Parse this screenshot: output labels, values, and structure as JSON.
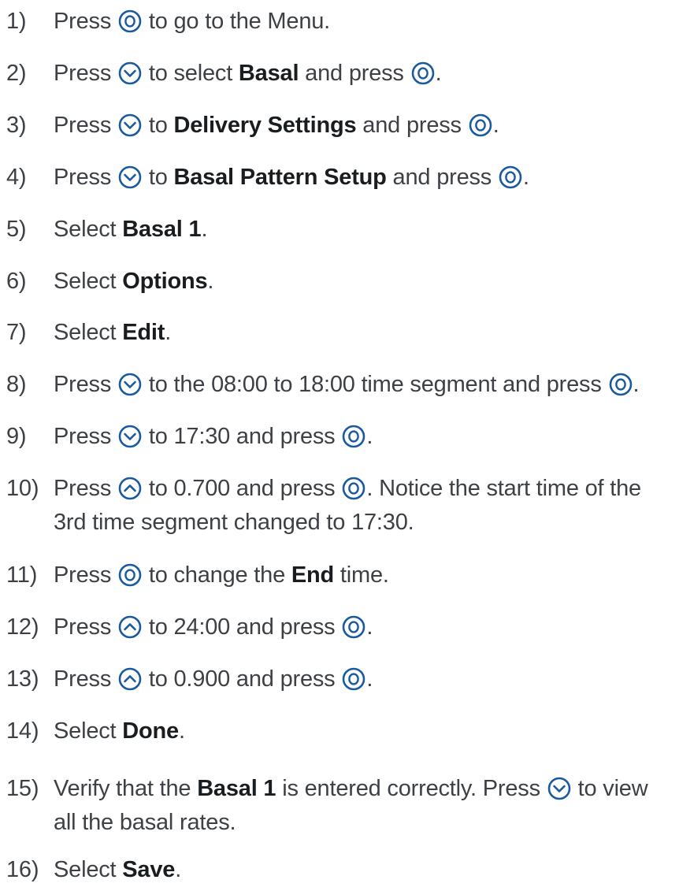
{
  "accent_color": "#1a5a9e",
  "icons": {
    "select": "select-button-icon",
    "down": "down-arrow-button-icon",
    "up": "up-arrow-button-icon"
  },
  "steps": [
    {
      "num": "1)",
      "p0": "Press",
      "p1": "to go to the Menu."
    },
    {
      "num": "2)",
      "p0": "Press",
      "p1": "to select",
      "b1": "Basal",
      "p2": "and press",
      "p3": "."
    },
    {
      "num": "3)",
      "p0": "Press",
      "p1": "to",
      "b1": "Delivery Settings",
      "p2": "and press",
      "p3": "."
    },
    {
      "num": "4)",
      "p0": "Press",
      "p1": "to",
      "b1": "Basal Pattern Setup",
      "p2": "and press",
      "p3": "."
    },
    {
      "num": "5)",
      "p0": "Select",
      "b1": "Basal 1",
      "p1": "."
    },
    {
      "num": "6)",
      "p0": "Select",
      "b1": "Options",
      "p1": "."
    },
    {
      "num": "7)",
      "p0": "Select",
      "b1": "Edit",
      "p1": "."
    },
    {
      "num": "8)",
      "p0": "Press",
      "p1": "to the 08:00 to 18:00 time segment and press",
      "p2": "."
    },
    {
      "num": "9)",
      "p0": "Press",
      "p1": "to 17:30 and press",
      "p2": "."
    },
    {
      "num": "10)",
      "p0": "Press",
      "p1": "to 0.700 and press",
      "p2": ". Notice the start time of the",
      "p3": "3rd time segment changed to 17:30."
    },
    {
      "num": "11)",
      "p0": "Press",
      "p1": "to change the",
      "b1": "End",
      "p2": "time."
    },
    {
      "num": "12)",
      "p0": "Press",
      "p1": "to 24:00 and press",
      "p2": "."
    },
    {
      "num": "13)",
      "p0": "Press",
      "p1": "to 0.900 and press",
      "p2": "."
    },
    {
      "num": "14)",
      "p0": "Select",
      "b1": "Done",
      "p1": "."
    },
    {
      "num": "15)",
      "p0": "Verify that the",
      "b1": "Basal 1",
      "p1": "is entered correctly. Press",
      "p2": "to view",
      "p3": "all the basal rates."
    },
    {
      "num": "16)",
      "p0": "Select",
      "b1": "Save",
      "p1": "."
    }
  ]
}
